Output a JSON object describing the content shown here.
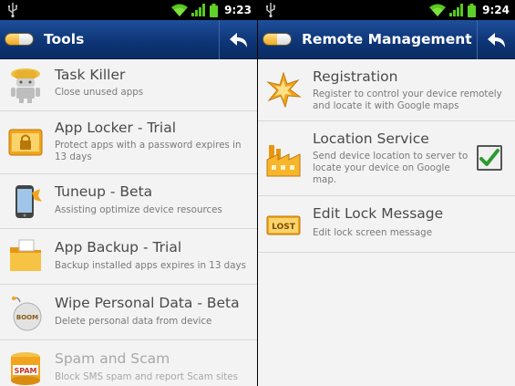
{
  "left": {
    "status": {
      "time": "9:23"
    },
    "title": "Tools",
    "items": [
      {
        "title": "Task Killer",
        "subtitle": "Close unused apps",
        "icon": "android-robot-icon"
      },
      {
        "title": "App Locker - Trial",
        "subtitle": "Protect apps with a password expires in 13 days",
        "icon": "lock-window-icon"
      },
      {
        "title": "Tuneup - Beta",
        "subtitle": "Assisting optimize device resources",
        "icon": "phone-tuneup-icon"
      },
      {
        "title": "App Backup - Trial",
        "subtitle": "Backup installed apps expires in 13 days",
        "icon": "backup-folder-icon"
      },
      {
        "title": "Wipe Personal Data - Beta",
        "subtitle": "Delete personal data from device",
        "icon": "boom-bomb-icon",
        "badge": "BOOM"
      },
      {
        "title": "Spam and Scam",
        "subtitle": "Block SMS spam and report Scam sites",
        "icon": "spam-can-icon",
        "badge": "SPAM"
      }
    ]
  },
  "right": {
    "status": {
      "time": "9:24"
    },
    "title": "Remote Management",
    "items": [
      {
        "title": "Registration",
        "subtitle": "Register to control your device remotely and locate it with Google maps",
        "icon": "spark-icon"
      },
      {
        "title": "Location Service",
        "subtitle": "Send device location to server to locate your device on Google map.",
        "icon": "factory-icon",
        "checked": true
      },
      {
        "title": "Edit Lock Message",
        "subtitle": "Edit lock screen message",
        "icon": "lost-sign-icon",
        "badge": "LOST"
      }
    ]
  },
  "colors": {
    "titlebar": "#0d3474",
    "check": "#2e9a2e",
    "battery": "#5fd02a"
  }
}
